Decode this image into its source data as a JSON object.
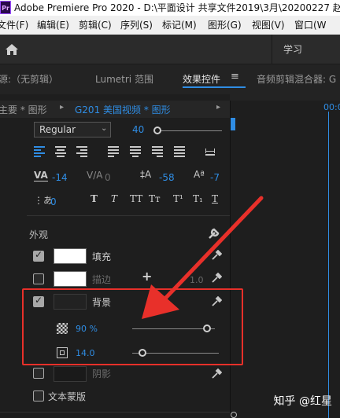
{
  "window": {
    "title": "Adobe Premiere Pro 2020 - D:\\平面设计 共享文件2019\\3月\\20200227 赵",
    "app_badge": "Pr"
  },
  "menu": [
    "文件(F)",
    "编辑(E)",
    "剪辑(C)",
    "序列(S)",
    "标记(M)",
    "图形(G)",
    "视图(V)",
    "窗口(W"
  ],
  "toolbar": {
    "workspace": "学习"
  },
  "tabs": {
    "source": "源:（无剪辑）",
    "lumetri": "Lumetri 范围",
    "effects": "效果控件",
    "audio": "音频剪辑混合器: G"
  },
  "panel_header": {
    "master": "主要 * 图形",
    "clip": "G201 美国视频 * 图形"
  },
  "timeline": {
    "timecode": "00:0"
  },
  "text": {
    "font_style": "Regular",
    "font_size": "40",
    "tracking": "-14",
    "kerning": "0",
    "leading": "-58",
    "baseline": "-7",
    "tsume": "0"
  },
  "appearance": {
    "title": "外观",
    "fill_label": "填充",
    "stroke_label": "描边",
    "stroke_width": "1.0",
    "background_label": "背景",
    "opacity_value": "90 %",
    "opacity_fraction": 0.9,
    "size_value": "14.0",
    "shadow_label": "阴影",
    "mask_label": "文本蒙版",
    "fill_color": "#ffffff",
    "stroke_color": "#ffffff",
    "background_color": "#222222"
  },
  "colors": {
    "accent": "#2f8de4",
    "annotation": "#e8302a"
  },
  "watermark": "知乎 @红星"
}
